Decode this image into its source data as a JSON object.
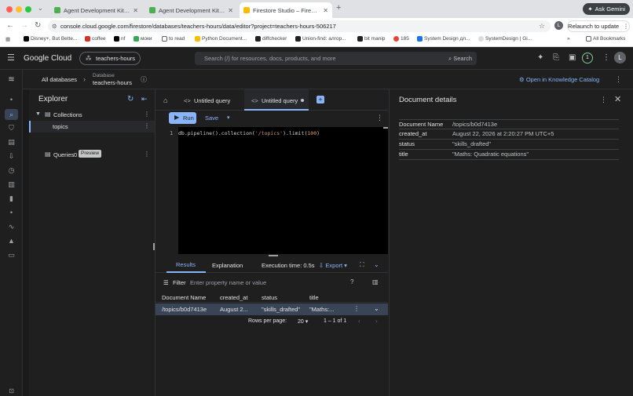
{
  "browser": {
    "tabs": [
      {
        "label": "Agent Development Kit Dev UI"
      },
      {
        "label": "Agent Development Kit Dev UI"
      },
      {
        "label": "Firestore Studio – Firestore"
      }
    ],
    "gemini_label": "Ask Gemini",
    "url": "console.cloud.google.com/firestore/databases/teachers-hours/data/editor?project=teachers-hours-506217",
    "relaunch_label": "Relaunch to update",
    "profile_initial": "L",
    "bookmarks": [
      {
        "label": "Disney+, But Bette..."
      },
      {
        "label": "coffee"
      },
      {
        "label": "nf"
      },
      {
        "label": "моки"
      },
      {
        "label": "to read"
      },
      {
        "label": "Python Document..."
      },
      {
        "label": "diffchecker"
      },
      {
        "label": "Union-find: алгор..."
      },
      {
        "label": "bit manip"
      },
      {
        "label": "185"
      },
      {
        "label": "System Design дл..."
      },
      {
        "label": "SystemDesign | Gi..."
      }
    ],
    "all_bookmarks_label": "All Bookmarks",
    "more_bookmarks": "»"
  },
  "gcp": {
    "brand": "Google Cloud",
    "project": "teachers-hours",
    "search_placeholder": "Search (/) for resources, docs, products, and more",
    "search_button": "Search",
    "notification_count": "1",
    "avatar_initial": "L"
  },
  "dbbar": {
    "all_databases": "All databases",
    "separator": "›",
    "db_caption": "Database",
    "db_name": "teachers-hours",
    "knowledge_catalog": "Open in Knowledge Catalog"
  },
  "explorer": {
    "title": "Explorer",
    "collections_label": "Collections",
    "collection_items": [
      {
        "label": "topics"
      }
    ],
    "queries_label": "Queries",
    "queries_count": "0",
    "preview_badge": "Preview"
  },
  "editor": {
    "tabs": [
      {
        "label": "Untitled query"
      },
      {
        "label": "Untitled query"
      }
    ],
    "run_label": "Run",
    "save_label": "Save",
    "line_number": "1",
    "code_prefix": "db.pipeline().collection(",
    "code_string": "'/topics'",
    "code_mid": ").limit(",
    "code_number": "100",
    "code_suffix": ")"
  },
  "results": {
    "tabs": [
      {
        "label": "Results"
      },
      {
        "label": "Explanation"
      }
    ],
    "execution_time": "Execution time: 0.5s",
    "export_label": "Export",
    "filter_label": "Filter",
    "filter_placeholder": "Enter property name or value",
    "columns": [
      "Document Name",
      "created_at",
      "status",
      "title"
    ],
    "rows": [
      {
        "name": "/topics/b0d7413e",
        "created_at": "August 2...",
        "status": "\"skills_drafted\"",
        "title": "\"Maths:..."
      }
    ],
    "rows_per_page_label": "Rows per page:",
    "rows_per_page": "20",
    "range": "1 – 1 of 1"
  },
  "details": {
    "title": "Document details",
    "fields": [
      {
        "key": "Document Name",
        "value": "/topics/b0d7413e"
      },
      {
        "key": "created_at",
        "value": "August 22, 2026 at 2:20:27 PM UTC+5"
      },
      {
        "key": "status",
        "value": "\"skills_drafted\""
      },
      {
        "key": "title",
        "value": "\"Maths: Quadratic equations\""
      }
    ]
  },
  "icons": {
    "traffic_red": "#ff5f57",
    "traffic_yellow": "#febc2e",
    "traffic_green": "#28c840",
    "accent": "#8ab4f8"
  }
}
